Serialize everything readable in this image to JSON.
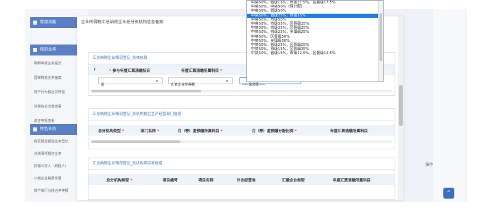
{
  "sidebar": {
    "common_functions": "常用功能",
    "my_business": "我的业务",
    "special_business": "特色业务",
    "items_a": [
      "明细申报业务提交",
      "国家税收业务备案",
      "财产行为税合并申报",
      "涉税信息交易查看",
      "返还申报查看"
    ],
    "items_b": [
      "跨区经营报验业务登记",
      "涉税事项报告业务",
      "扣缴义务人（纳税人）",
      "小微企业税费优惠",
      "财产和行为税合并申报"
    ]
  },
  "dialog": {
    "title": "企业所得税汇总纳税企业总分支机构信息备案",
    "section1": {
      "title": "汇总纳税企业情况登记_总体信息",
      "headers": [
        "参与年度汇算清缴标识",
        "年度汇算清缴所属科目",
        "I"
      ],
      "row": {
        "flag": "是",
        "subject": "扎管企业所得税",
        "select": "-----请选择-----"
      }
    },
    "section2": {
      "title": "汇总纳税企业情况登记_总机构独立生产经营部门信息",
      "headers": [
        "总分机构类型",
        "部门名称",
        "月（季）度预缴所属科目",
        "月（季）度预缴分配比例",
        "年度汇算清缴所属科目"
      ]
    },
    "section3": {
      "title": "汇总纳税企业情况登记_总机构项目部信息",
      "headers": [
        "总分机构类型",
        "项目编号",
        "项目名称",
        "外出经营地",
        "汇缴企业类型",
        "年度汇算清缴所属科目"
      ]
    }
  },
  "dropdown": {
    "options": [
      "中央50%，省级15%，市级17.5%，区县级17.5%",
      "中央50%，中央50%（待分配）",
      "中央50%，省级50%",
      "中央50%，省级25%，市级25%",
      "中央50%，市级50%",
      "中央50%，市级35%，区县级15%",
      "中央50%，市级25%，区县级25%",
      "中央50%，市级25%，乡镇级25%",
      "中央50%，区县级50%",
      "中央50%，乡镇级50%",
      "中央50%，省级25%，区县级25%",
      "中央50%，市级15%，区县级35%",
      "中央50%，省级15%，市级12.5%，区县级12.5%"
    ],
    "selected_index": 3
  },
  "right": {
    "operation": "操作"
  },
  "colors": {
    "accent": "#5a7fc4",
    "selected": "#1e7de0",
    "link": "#3a6fc0"
  }
}
